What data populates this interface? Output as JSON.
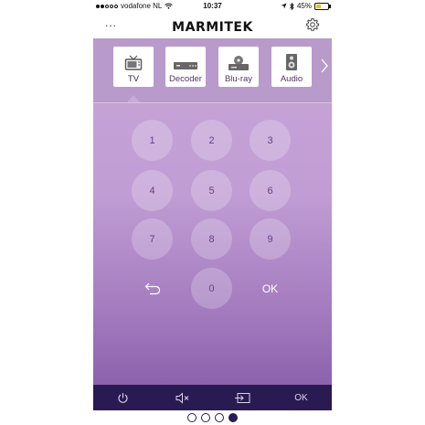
{
  "status_bar": {
    "carrier": "vodafone NL",
    "time": "10:37",
    "battery": "45%",
    "battery_level": 0.45
  },
  "header": {
    "menu_label": "...",
    "logo": "MARMITEK",
    "settings_icon": "gear-icon"
  },
  "devices": [
    {
      "label": "TV",
      "icon": "tv-icon",
      "selected": true
    },
    {
      "label": "Decoder",
      "icon": "decoder-icon",
      "selected": false
    },
    {
      "label": "Blu-ray",
      "icon": "bluray-icon",
      "selected": false
    },
    {
      "label": "Audio",
      "icon": "speaker-icon",
      "selected": false
    }
  ],
  "keypad": {
    "keys": [
      "1",
      "2",
      "3",
      "4",
      "5",
      "6",
      "7",
      "8",
      "9",
      "0"
    ],
    "back_icon": "back-arrow-icon",
    "ok_label": "OK"
  },
  "bottom_bar": {
    "power_icon": "power-icon",
    "mute_icon": "mute-icon",
    "source_icon": "input-source-icon",
    "ok_label": "OK"
  },
  "pager": {
    "pages": 4,
    "active": 4
  },
  "colors": {
    "header_bg": "#ffffff",
    "panel_top": "#c7a6d8",
    "panel_bottom": "#8d62ae",
    "bottom_bar": "#2a1a52",
    "battery": "#f2c200"
  }
}
